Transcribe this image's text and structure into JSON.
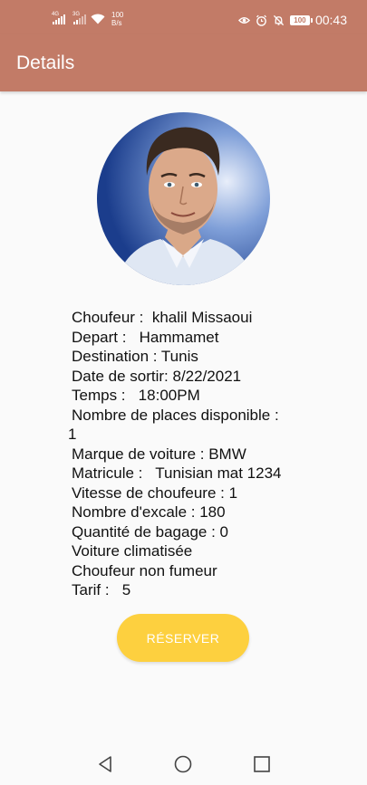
{
  "status_bar": {
    "network_1": "4G",
    "network_2": "3G",
    "speed_value": "100",
    "speed_unit": "B/s",
    "battery": "100",
    "time": "00:43",
    "icons": [
      "eye-icon",
      "alarm-icon",
      "bell-off-icon"
    ]
  },
  "app_bar": {
    "title": "Details"
  },
  "details": {
    "chauffeur": "Choufeur :  khalil Missaoui",
    "depart": "Depart :   Hammamet",
    "destination": "Destination : Tunis",
    "date": "Date de sortir: 8/22/2021",
    "temps": "Temps :   18:00PM",
    "places_label": "Nombre de places disponible :",
    "places_value": "1",
    "marque": "Marque de voiture : BMW",
    "matricule": "Matricule :   Tunisian mat 1234",
    "vitesse": "Vitesse de choufeure : 1",
    "escale": "Nombre d'excale : 180",
    "bagage": "Quantité de bagage : 0",
    "climatisee": "Voiture climatisée",
    "fumeur": "Choufeur non fumeur",
    "tarif": "Tarif :   5"
  },
  "actions": {
    "reserve_label": "RÉSERVER"
  },
  "colors": {
    "primary": "#c27b67",
    "accent": "#fdd03f",
    "background": "#fafafa"
  },
  "nav_bar": {
    "icons": [
      "back-icon",
      "home-icon",
      "recents-icon"
    ]
  }
}
